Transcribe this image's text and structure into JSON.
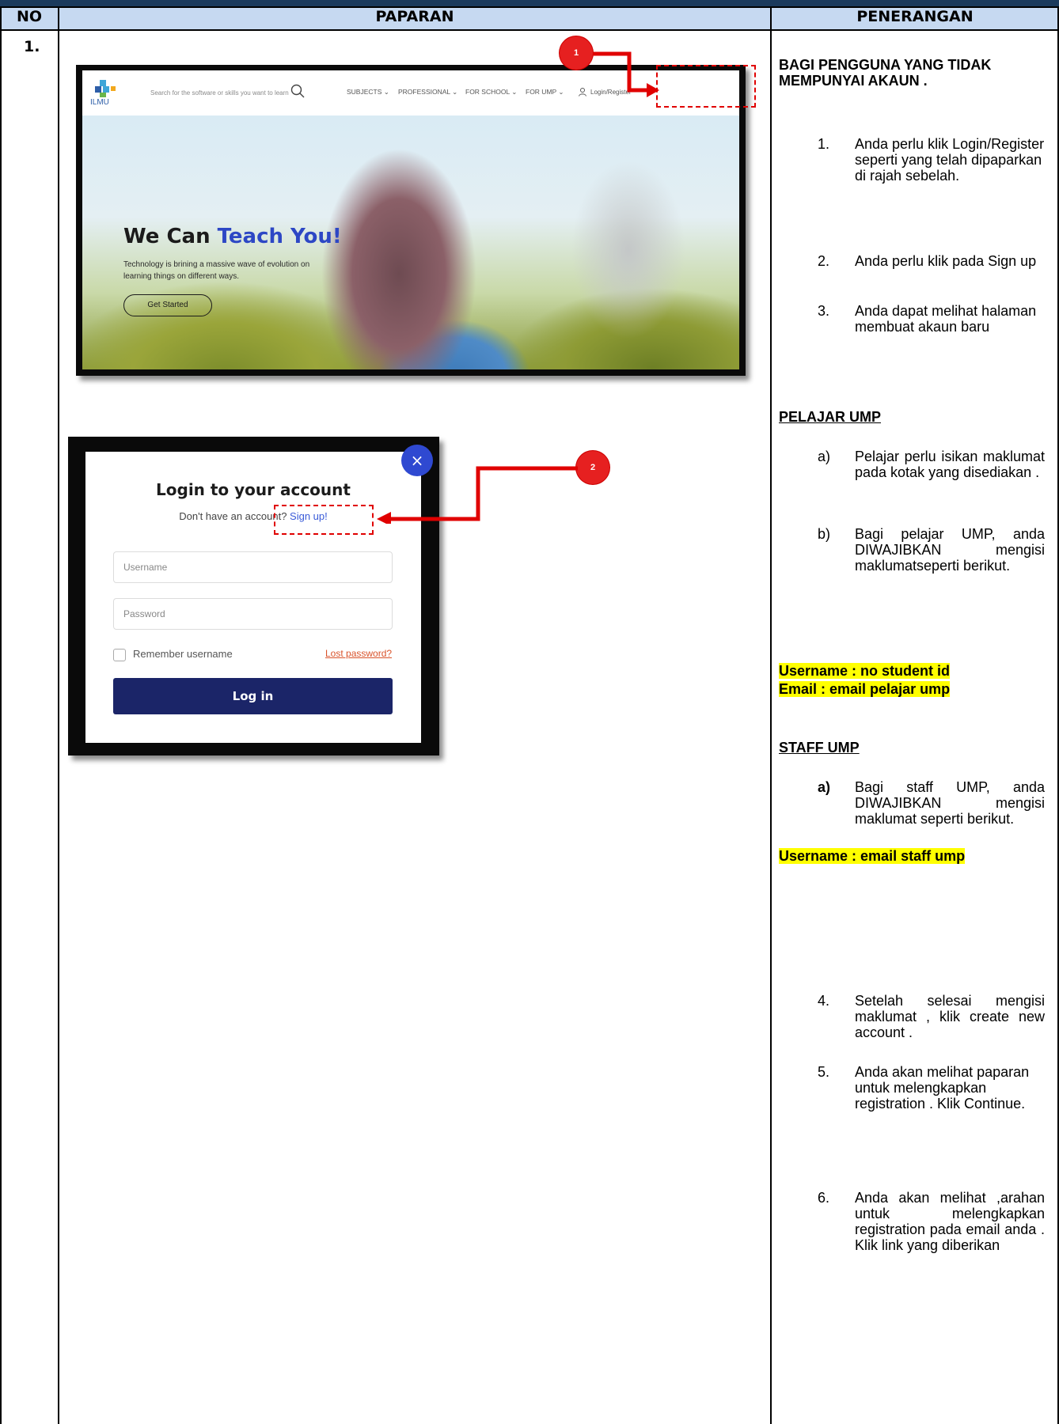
{
  "table": {
    "headers": {
      "no": "NO",
      "paparan": "PAPARAN",
      "penerangan": "PENERANGAN"
    },
    "row_number": "1."
  },
  "screenshot_site": {
    "logo_text": "ILMU",
    "search_placeholder": "Search for the software or skills you want to learn",
    "nav": [
      "SUBJECTS ⌄",
      "PROFESSIONAL ⌄",
      "FOR SCHOOL ⌄",
      "FOR UMP ⌄"
    ],
    "login_register": "Login/Register",
    "hero_title_1": "We Can ",
    "hero_title_2": "Teach You!",
    "hero_text": "Technology is brining a massive wave of evolution on learning things on different ways.",
    "hero_button": "Get Started"
  },
  "callouts": {
    "badge_1": "1",
    "badge_2": "2"
  },
  "login_modal": {
    "title": "Login to your account",
    "prompt": "Don't have an account? ",
    "signup_link": "Sign up!",
    "username_placeholder": "Username",
    "password_placeholder": "Password",
    "remember_label": "Remember username",
    "lost_password": "Lost password?",
    "login_button": "Log in",
    "close": "×"
  },
  "instructions": {
    "heading": "BAGI PENGGUNA YANG TIDAK MEMPUNYAI AKAUN .",
    "steps": [
      {
        "num": "1.",
        "text": "Anda perlu klik Login/Register seperti yang telah dipaparkan di rajah sebelah."
      },
      {
        "num": "2.",
        "text": "Anda perlu klik pada Sign up"
      },
      {
        "num": "3.",
        "text": "Anda dapat melihat halaman membuat akaun baru"
      }
    ],
    "pelajar": {
      "title": "PELAJAR UMP",
      "items": [
        {
          "num": "a)",
          "text": "Pelajar perlu isikan maklumat pada kotak yang disediakan ."
        },
        {
          "num": "b)",
          "text": "Bagi pelajar UMP, anda DIWAJIBKAN mengisi maklumatseperti berikut."
        }
      ],
      "highlight_1": "Username : no student id",
      "highlight_2": "Email : email pelajar ump"
    },
    "staff": {
      "title": "STAFF UMP",
      "items": [
        {
          "num": "a)",
          "text": "Bagi staff UMP, anda DIWAJIBKAN mengisi maklumat seperti berikut."
        }
      ],
      "highlight": "Username : email staff ump"
    },
    "steps_later": [
      {
        "num": "4.",
        "text": "Setelah selesai mengisi maklumat , klik create new account ."
      },
      {
        "num": "5.",
        "text": "Anda akan melihat paparan untuk melengkapkan registration . Klik Continue."
      },
      {
        "num": "6.",
        "text": "Anda akan melihat ,arahan untuk melengkapkan registration pada email anda . Klik link yang diberikan"
      }
    ]
  },
  "colors": {
    "header_bg": "#c6d9f1",
    "highlight": "#ffff00",
    "callout_red": "#e00000",
    "modal_button": "#1b2568",
    "accent_blue": "#2d47c5"
  }
}
